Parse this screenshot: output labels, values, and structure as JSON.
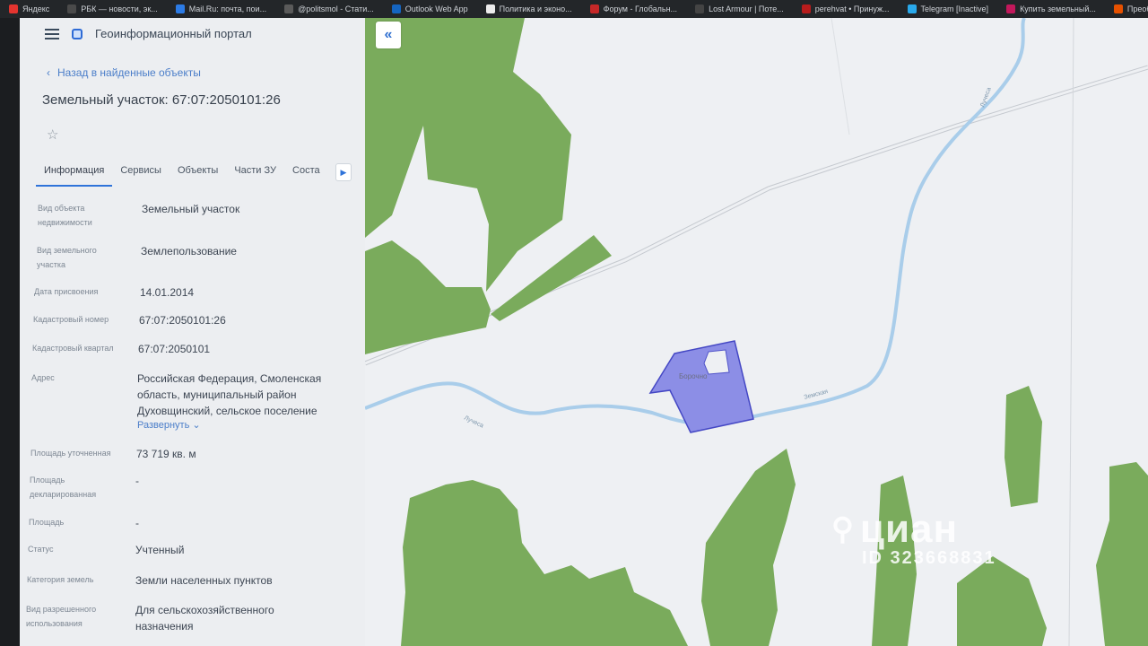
{
  "bookmarks": [
    {
      "label": "Яндекс",
      "color": "#e3342f"
    },
    {
      "label": "РБК — новости, эк...",
      "color": "#4a4a4a"
    },
    {
      "label": "Mail.Ru: почта, пои...",
      "color": "#2c7be5"
    },
    {
      "label": "@politsmol - Стати...",
      "color": "#5a5a5a"
    },
    {
      "label": "Outlook Web App",
      "color": "#1565c0"
    },
    {
      "label": "Политика и эконо...",
      "color": "#ececec"
    },
    {
      "label": "Форум - Глобальн...",
      "color": "#c62828"
    },
    {
      "label": "Lost Armour | Поте...",
      "color": "#444"
    },
    {
      "label": "perehvat • Принуж...",
      "color": "#b71c1c"
    },
    {
      "label": "Telegram [Inactive]",
      "color": "#29a9eb"
    },
    {
      "label": "Купить земельный...",
      "color": "#c2185b"
    },
    {
      "label": "Преобразован...",
      "color": "#e65100"
    }
  ],
  "header": {
    "title": "Геоинформационный портал"
  },
  "back_label": "Назад в найденные объекты",
  "object_title": "Земельный участок: 67:07:2050101:26",
  "tabs": [
    "Информация",
    "Сервисы",
    "Объекты",
    "Части ЗУ",
    "Соста"
  ],
  "fields": {
    "obj_type": {
      "label1": "Вид объекта",
      "label2": "недвижимости",
      "value": "Земельный участок"
    },
    "plot_type": {
      "label1": "Вид земельного",
      "label2": "участка",
      "value": "Землепользование"
    },
    "date": {
      "label1": "Дата присвоения",
      "value": "14.01.2014"
    },
    "cad_number": {
      "label1": "Кадастровый номер",
      "value": "67:07:2050101:26"
    },
    "cad_quarter": {
      "label1": "Кадастровый квартал",
      "value": "67:07:2050101"
    },
    "address": {
      "label1": "Адрес",
      "line1": "Российская Федерация, Смоленская",
      "line2": "область, муниципальный район",
      "line3": "Духовщинский, сельское поселение",
      "expand": "Развернуть"
    },
    "area_precise": {
      "label1": "Площадь уточненная",
      "value": "73 719 кв. м"
    },
    "area_declared": {
      "label1": "Площадь",
      "label2": "декларированная",
      "value": "-"
    },
    "area": {
      "label1": "Площадь",
      "value": "-"
    },
    "status": {
      "label1": "Статус",
      "value": "Учтенный"
    },
    "land_category": {
      "label1": "Категория земель",
      "value": "Земли населенных пунктов"
    },
    "permitted_use": {
      "label1": "Вид разрешенного",
      "label2": "использования",
      "line1": "Для сельскохозяйственного",
      "line2": "назначения"
    }
  },
  "map": {
    "parcel_label": "Борочно",
    "river_labels": [
      "Лучеса",
      "Земская",
      "Лучеса"
    ],
    "colors": {
      "forest": "#7aab5c",
      "parcel": "#8c8ee6",
      "river": "#a9cdea",
      "road": "#c8ccd2"
    }
  },
  "watermark": {
    "brand": "циан",
    "id": "ID 323668831"
  }
}
